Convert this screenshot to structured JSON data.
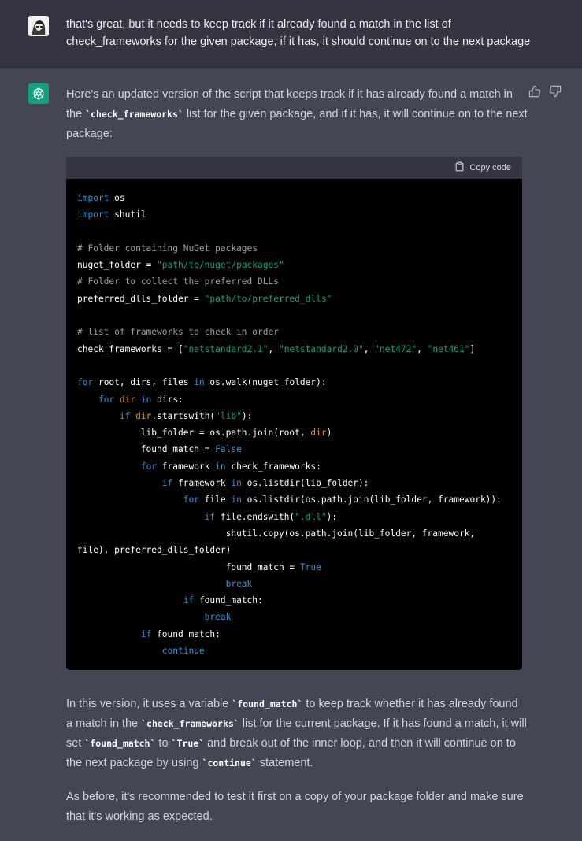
{
  "user_message": {
    "text": "that's great, but it needs to keep track if it already found a match in the list of check_frameworks for the given package, if it has, it should continue on to the next package"
  },
  "assistant_message": {
    "intro_part1": "Here's an updated version of the script that keeps track if it has already found a match in the ",
    "intro_code": "`check_frameworks`",
    "intro_part2": " list for the given package, and if it has, it will continue on to the next package:",
    "copy_label": "Copy code",
    "code_lines": [
      "import os",
      "import shutil",
      "",
      "# Folder containing NuGet packages",
      "nuget_folder = \"path/to/nuget/packages\"",
      "# Folder to collect the preferred DLLs",
      "preferred_dlls_folder = \"path/to/preferred_dlls\"",
      "",
      "# list of frameworks to check in order",
      "check_frameworks = [\"netstandard2.1\", \"netstandard2.0\", \"net472\", \"net461\"]",
      "",
      "for root, dirs, files in os.walk(nuget_folder):",
      "    for dir in dirs:",
      "        if dir.startswith(\"lib\"):",
      "            lib_folder = os.path.join(root, dir)",
      "            found_match = False",
      "            for framework in check_frameworks:",
      "                if framework in os.listdir(lib_folder):",
      "                    for file in os.listdir(os.path.join(lib_folder, framework)):",
      "                        if file.endswith(\".dll\"):",
      "                            shutil.copy(os.path.join(lib_folder, framework,",
      "file), preferred_dlls_folder)",
      "                            found_match = True",
      "                            break",
      "                    if found_match:",
      "                        break",
      "            if found_match:",
      "                continue"
    ],
    "explanation": {
      "t1": "In this version, it uses a variable ",
      "c1": "`found_match`",
      "t2": " to keep track whether it has already found a match in the ",
      "c2": "`check_frameworks`",
      "t3": " list for the current package. If it has found a match, it will set ",
      "c3": "`found_match`",
      "t4": " to ",
      "c4": "`True`",
      "t5": " and break out of the inner loop, and then it will continue on to the next package by using ",
      "c5": "`continue`",
      "t6": " statement."
    },
    "closing": "As before, it's recommended to test it first on a copy of your package folder and make sure that it's working as expected."
  },
  "colors": {
    "keyword": "#2e95d3",
    "string": "#00a67d",
    "comment": "#9ea0a5",
    "assistant_avatar": "#10a37f"
  },
  "icons": [
    "user-avatar",
    "openai-logo-icon",
    "thumbs-up-icon",
    "thumbs-down-icon",
    "clipboard-icon"
  ]
}
